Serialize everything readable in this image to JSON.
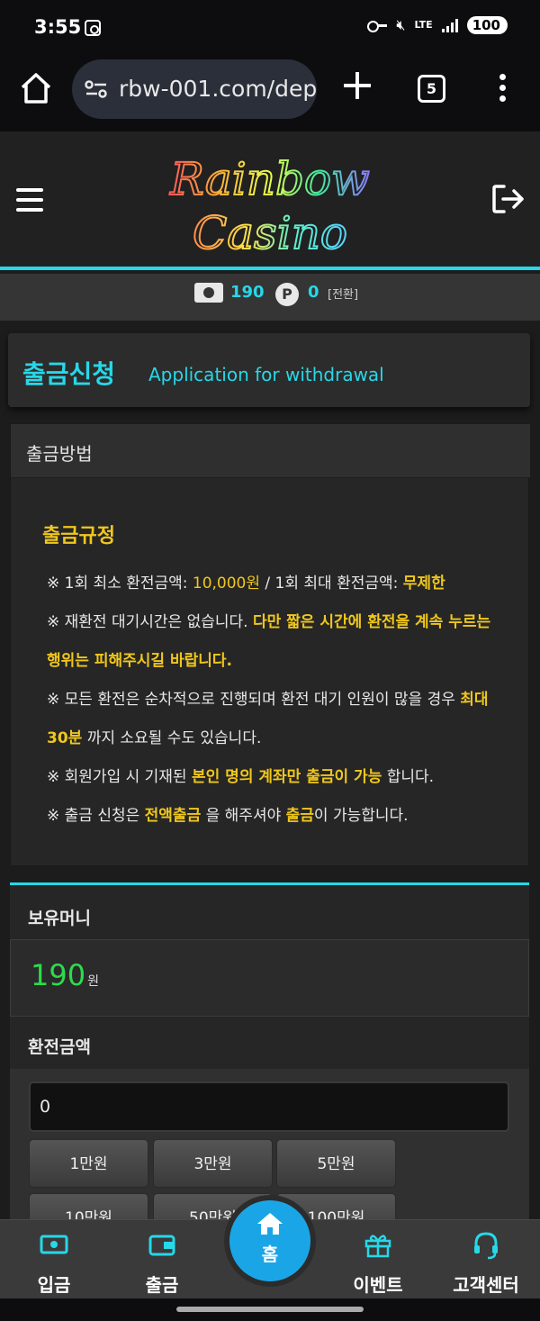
{
  "status_bar": {
    "time": "3:55",
    "network": "LTE",
    "battery": "100"
  },
  "browser": {
    "url": "rbw-001.com/dep",
    "tab_count": "5"
  },
  "header": {
    "logo_line1": "Rainbow",
    "logo_line2": "Casino"
  },
  "balance": {
    "money": "190",
    "points": "0",
    "point_symbol": "P",
    "convert_label": "[전환]"
  },
  "page_title": {
    "korean": "출금신청",
    "english": "Application for withdrawal"
  },
  "method": {
    "header": "출금방법",
    "rules_title": "출금규정",
    "rules": [
      {
        "parts": [
          {
            "t": "※ 1회 최소 환전금액: ",
            "s": ""
          },
          {
            "t": "10,000원",
            "s": "y"
          },
          {
            "t": " / 1회 최대 환전금액: ",
            "s": ""
          },
          {
            "t": "무제한",
            "s": "yb"
          }
        ]
      },
      {
        "parts": [
          {
            "t": "※ 재환전 대기시간은 없습니다. ",
            "s": ""
          },
          {
            "t": "다만 짧은 시간에 환전을 계속 누르는 행위는 피해주시길 바랍니다.",
            "s": "yb"
          }
        ]
      },
      {
        "parts": [
          {
            "t": "※ 모든 환전은 순차적으로 진행되며 환전 대기 인원이 많을 경우 ",
            "s": ""
          },
          {
            "t": "최대 30분",
            "s": "yb"
          },
          {
            "t": " 까지 소요될 수도 있습니다.",
            "s": ""
          }
        ]
      },
      {
        "parts": [
          {
            "t": "※ 회원가입 시 기재된 ",
            "s": ""
          },
          {
            "t": "본인 명의 계좌만 출금이 가능",
            "s": "yb"
          },
          {
            "t": " 합니다.",
            "s": ""
          }
        ]
      },
      {
        "parts": [
          {
            "t": "※ 출금 신청은 ",
            "s": ""
          },
          {
            "t": "전액출금",
            "s": "yb"
          },
          {
            "t": " 을 해주셔야 ",
            "s": ""
          },
          {
            "t": "출금",
            "s": "yb"
          },
          {
            "t": "이 가능합니다.",
            "s": ""
          }
        ]
      }
    ]
  },
  "money_section": {
    "own_label": "보유머니",
    "own_value": "190",
    "own_unit": "원",
    "amount_label": "환전금액",
    "amount_value": "0",
    "quick_buttons": [
      "1만원",
      "3만원",
      "5만원",
      "10만원",
      "50만원",
      "100만원"
    ]
  },
  "bottom_nav": {
    "deposit": "입금",
    "withdraw": "출금",
    "home": "홈",
    "event": "이벤트",
    "support": "고객센터"
  },
  "colors": {
    "accent": "#26d8e8",
    "highlight": "#f0c71c",
    "money_green": "#2cdc4a",
    "home_blue": "#1aa6e6"
  }
}
